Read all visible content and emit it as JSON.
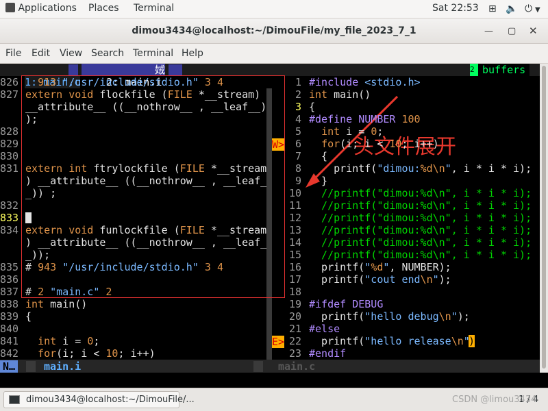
{
  "topbar": {
    "applications": "Applications",
    "places": "Places",
    "terminal": "Terminal",
    "clock": "Sat 22:53"
  },
  "window": {
    "title": "dimou3434@localhost:~/DimouFile/my_file_2023_7_1"
  },
  "menu": [
    "File",
    "Edit",
    "View",
    "Search",
    "Terminal",
    "Help"
  ],
  "vim": {
    "tabs": {
      "tab1": "1: main.c",
      "tab2": "2: main.i",
      "tab2_suffix": "娀",
      "buffers": "buffers"
    },
    "left": {
      "lines": [
        {
          "n": "826",
          "t": "  913 \"/usr/include/stdio.h\" 3 4"
        },
        {
          "n": "827",
          "t": "extern void flockfile (FILE *__stream)"
        },
        {
          "n": "",
          "t": "__attribute__ ((__nothrow__ , __leaf__)"
        },
        {
          "n": "",
          "t": ");"
        },
        {
          "n": "828",
          "t": ""
        },
        {
          "n": "829",
          "t": ""
        },
        {
          "n": "830",
          "t": ""
        },
        {
          "n": "831",
          "t": "extern int ftrylockfile (FILE *__stream"
        },
        {
          "n": "",
          "t": ") __attribute__ ((__nothrow__ , __leaf_"
        },
        {
          "n": "",
          "t": "_)) ;"
        },
        {
          "n": "832",
          "t": ""
        },
        {
          "n": "833",
          "t": ""
        },
        {
          "n": "834",
          "t": "extern void funlockfile (FILE *__stream"
        },
        {
          "n": "",
          "t": ") __attribute__ ((__nothrow__ , __leaf_"
        },
        {
          "n": "",
          "t": "_));"
        },
        {
          "n": "835",
          "t": "# 943 \"/usr/include/stdio.h\" 3 4"
        },
        {
          "n": "836",
          "t": ""
        },
        {
          "n": "837",
          "t": "# 2 \"main.c\" 2"
        },
        {
          "n": "838",
          "t": "int main()"
        },
        {
          "n": "839",
          "t": "{"
        },
        {
          "n": "840",
          "t": ""
        },
        {
          "n": "841",
          "t": "  int i = 0;"
        },
        {
          "n": "842",
          "t": "  for(i; i < 10; i++)"
        }
      ],
      "status_mode": "N…",
      "status_file": "main.i"
    },
    "right": {
      "lines": [
        {
          "n": "1",
          "t": "#include <stdio.h>"
        },
        {
          "n": "2",
          "t": "int main()"
        },
        {
          "n": "3",
          "t": "{"
        },
        {
          "n": "4",
          "t": "#define NUMBER 100"
        },
        {
          "n": "5",
          "t": "  int i = 0;"
        },
        {
          "n": "6",
          "t": "  for(i; i < 10; i++)"
        },
        {
          "n": "7",
          "t": "  {"
        },
        {
          "n": "8",
          "t": "    printf(\"dimou:%d\\n\", i * i * i);"
        },
        {
          "n": "9",
          "t": "  }"
        },
        {
          "n": "10",
          "t": "  //printf(\"dimou:%d\\n\", i * i * i);"
        },
        {
          "n": "11",
          "t": "  //printf(\"dimou:%d\\n\", i * i * i);"
        },
        {
          "n": "12",
          "t": "  //printf(\"dimou:%d\\n\", i * i * i);"
        },
        {
          "n": "13",
          "t": "  //printf(\"dimou:%d\\n\", i * i * i);"
        },
        {
          "n": "14",
          "t": "  //printf(\"dimou:%d\\n\", i * i * i);"
        },
        {
          "n": "15",
          "t": "  //printf(\"dimou:%d\\n\", i * i * i);"
        },
        {
          "n": "16",
          "t": "  printf(\"%d\", NUMBER);"
        },
        {
          "n": "17",
          "t": "  printf(\"cout end\\n\");"
        },
        {
          "n": "18",
          "t": ""
        },
        {
          "n": "19",
          "t": "#ifdef DEBUG"
        },
        {
          "n": "20",
          "t": "  printf(\"hello debug\\n\");"
        },
        {
          "n": "21",
          "t": "#else"
        },
        {
          "n": "22",
          "t": "  printf(\"hello release\\n\")"
        },
        {
          "n": "23",
          "t": "#endif"
        }
      ],
      "status_file": "main.c"
    },
    "signs": {
      "w": "W>",
      "e": "E>"
    }
  },
  "annotation": {
    "text": "头文件展开",
    "color": "#e8382d"
  },
  "taskbar": {
    "item": "dimou3434@localhost:~/DimouFile/...",
    "page": "1 / 4"
  },
  "watermark": "CSDN @limou3434"
}
